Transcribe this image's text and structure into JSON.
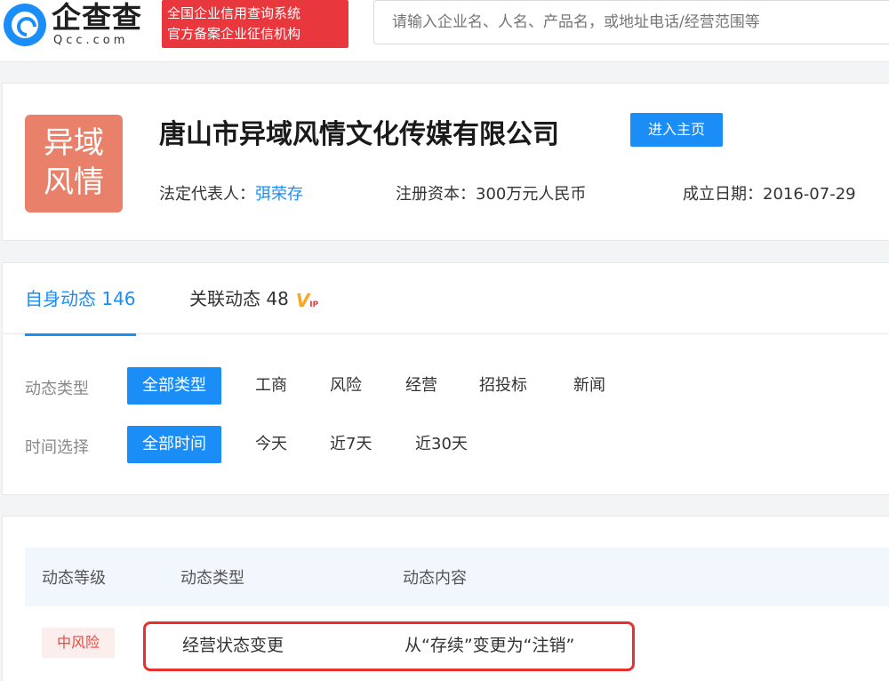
{
  "header": {
    "logo_cn": "企查查",
    "logo_en": "Qcc.com",
    "slogan_line1": "全国企业信用查询系统",
    "slogan_line2": "官方备案企业征信机构",
    "search_placeholder": "请输入企业名、人名、产品名，或地址电话/经营范围等"
  },
  "company": {
    "logo_line1": "异域",
    "logo_line2": "风情",
    "name": "唐山市异域风情文化传媒有限公司",
    "home_button": "进入主页",
    "legal_rep_label": "法定代表人：",
    "legal_rep_value": "弭荣存",
    "capital_label": "注册资本：",
    "capital_value": "300万元人民币",
    "founded_label": "成立日期：",
    "founded_value": "2016-07-29"
  },
  "tabs": {
    "self": "自身动态 146",
    "related": "关联动态 48",
    "vip_text": "V",
    "vip_small": "IP"
  },
  "filters": {
    "type_label": "动态类型",
    "type_options": [
      "全部类型",
      "工商",
      "风险",
      "经营",
      "招投标",
      "新闻"
    ],
    "time_label": "时间选择",
    "time_options": [
      "全部时间",
      "今天",
      "近7天",
      "近30天"
    ]
  },
  "table": {
    "headers": [
      "动态等级",
      "动态类型",
      "动态内容"
    ],
    "rows": [
      {
        "level": "中风险",
        "type": "经营状态变更",
        "content": "从“存续”变更为“注销”"
      }
    ]
  },
  "colors": {
    "primary": "#1a8df7",
    "slogan_red": "#e8383d",
    "highlight_red": "#e8312f",
    "logo_bg": "#e8806a"
  }
}
